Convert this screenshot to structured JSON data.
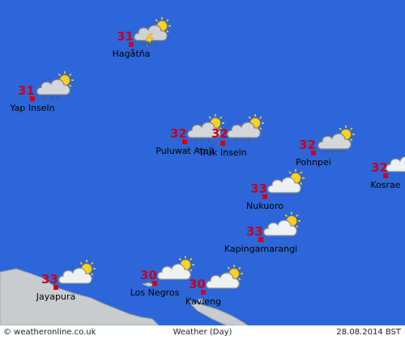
{
  "map": {
    "colors": {
      "ocean": "#2d66d8",
      "land": "#c9ccce",
      "coast": "#9aa2a8",
      "temp": "#c8001e",
      "marker": "#d00018"
    },
    "stations": [
      {
        "id": "hagatna",
        "name": "Hagåtña",
        "temp": "31",
        "icon": "thunderstorm-sun-icon"
      },
      {
        "id": "yap",
        "name": "Yap Inseln",
        "temp": "31",
        "icon": "rain-shower-sun-icon"
      },
      {
        "id": "puluwat",
        "name": "Puluwat Atoll",
        "temp": "32",
        "icon": "rain-shower-sun-icon"
      },
      {
        "id": "truk",
        "name": "Truk Inseln",
        "temp": "32",
        "icon": "rain-shower-sun-icon"
      },
      {
        "id": "pohnpei",
        "name": "Pohnpei",
        "temp": "32",
        "icon": "rain-shower-sun-icon"
      },
      {
        "id": "kosrae",
        "name": "Kosrae",
        "temp": "32",
        "icon": "partly-cloudy-icon"
      },
      {
        "id": "nukuoro",
        "name": "Nukuoro",
        "temp": "33",
        "icon": "partly-cloudy-icon"
      },
      {
        "id": "kapingamarangi",
        "name": "Kapingamarangi",
        "temp": "33",
        "icon": "partly-cloudy-icon"
      },
      {
        "id": "jayapura",
        "name": "Jayapura",
        "temp": "33",
        "icon": "partly-cloudy-icon"
      },
      {
        "id": "losnegros",
        "name": "Los Negros",
        "temp": "30",
        "icon": "partly-cloudy-icon"
      },
      {
        "id": "kavieng",
        "name": "Kavieng",
        "temp": "30",
        "icon": "partly-cloudy-icon"
      }
    ]
  },
  "footer": {
    "copyright": "© weatheronline.co.uk",
    "title": "Weather (Day)",
    "date": "28.08.2014 BST"
  }
}
